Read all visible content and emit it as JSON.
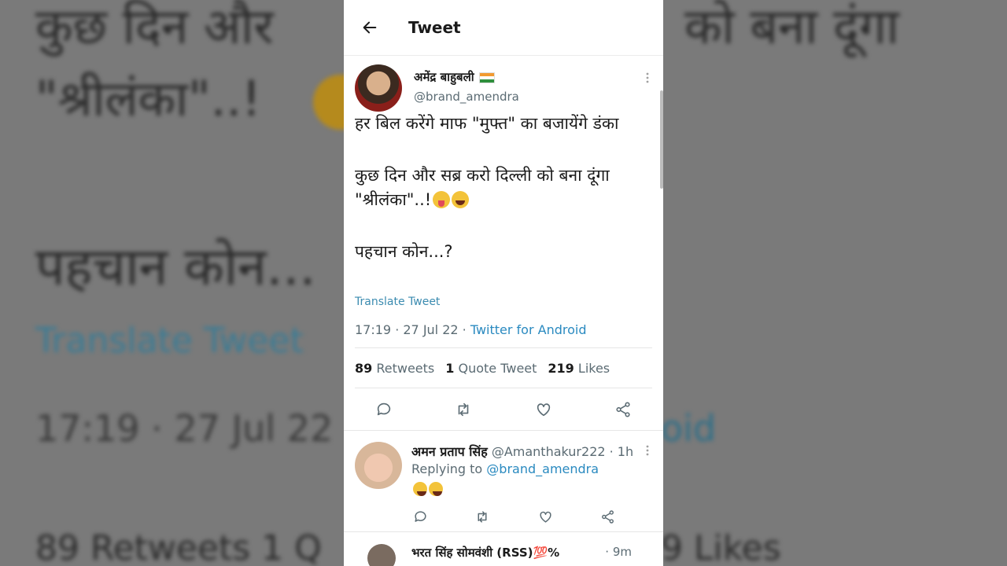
{
  "header": {
    "title": "Tweet"
  },
  "background": {
    "line1_left": "कुछ दिन और",
    "line1_right": "को बना दूंगा",
    "line2": "\"श्रीलंका\"..!",
    "line3": "पहचान कोन...",
    "translate": "Translate Tweet",
    "time": "17:19 · 27 Jul 22",
    "source_frag": "oid",
    "bottom_left": "89 Retweets   1 Q",
    "bottom_right": "9 Likes"
  },
  "tweet": {
    "author_name": "अमेंद्र बाहुबली",
    "author_handle": "@brand_amendra",
    "body_p1": "हर बिल करेंगे माफ \"मुफ्त\" का बजायेंगे डंका",
    "body_p2": "कुछ दिन और सब्र करो दिल्ली को बना दूंगा \"श्रीलंका\"..!",
    "body_p3": "पहचान कोन...?",
    "translate_label": "Translate Tweet",
    "time": "17:19 · 27 Jul 22 · ",
    "source": "Twitter for Android",
    "retweets_count": "89",
    "retweets_label": "Retweets",
    "quotes_count": "1",
    "quotes_label": "Quote Tweet",
    "likes_count": "219",
    "likes_label": "Likes"
  },
  "reply": {
    "name": "अमन प्रताप सिंह",
    "handle_time": " @Amanthakur222 · 1h",
    "replying_prefix": "Replying to ",
    "replying_handle": "@brand_amendra"
  },
  "next_reply": {
    "name": "भरत सिंह सोमवंशी (RSS)💯%",
    "time": "· 9m"
  },
  "icons": [
    "back-arrow-icon",
    "more-icon",
    "reply-icon",
    "retweet-icon",
    "like-icon",
    "share-icon",
    "flag-icon",
    "emoji-tongue-icon",
    "emoji-laugh-icon"
  ]
}
